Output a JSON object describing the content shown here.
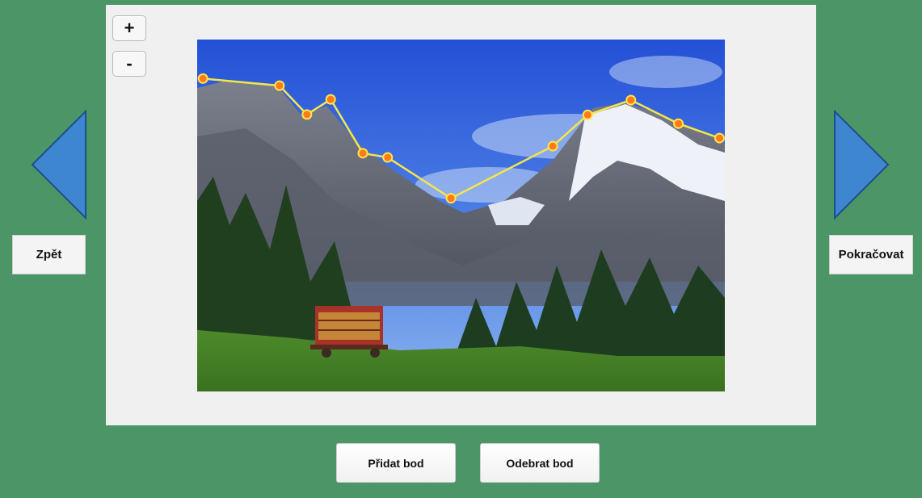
{
  "colors": {
    "background": "#4b9566",
    "panel": "#f0f0f0",
    "arrow_fill": "#3f86d1",
    "arrow_stroke": "#1d4f8c",
    "polyline": "#f4e64a",
    "point_fill": "#ff7a1a",
    "point_stroke": "#ffe34d"
  },
  "zoom": {
    "in_label": "+",
    "out_label": "-"
  },
  "nav": {
    "back_label": "Zpět",
    "next_label": "Pokračovat",
    "left_icon": "triangle-left-icon",
    "right_icon": "triangle-right-icon"
  },
  "actions": {
    "add_point_label": "Přidat bod",
    "remove_point_label": "Odebrat bod"
  },
  "ridgeline_points": [
    [
      0.011,
      0.111
    ],
    [
      0.156,
      0.131
    ],
    [
      0.208,
      0.213
    ],
    [
      0.253,
      0.17
    ],
    [
      0.314,
      0.323
    ],
    [
      0.361,
      0.335
    ],
    [
      0.481,
      0.451
    ],
    [
      0.674,
      0.303
    ],
    [
      0.74,
      0.214
    ],
    [
      0.822,
      0.172
    ],
    [
      0.912,
      0.239
    ],
    [
      0.99,
      0.28
    ]
  ]
}
